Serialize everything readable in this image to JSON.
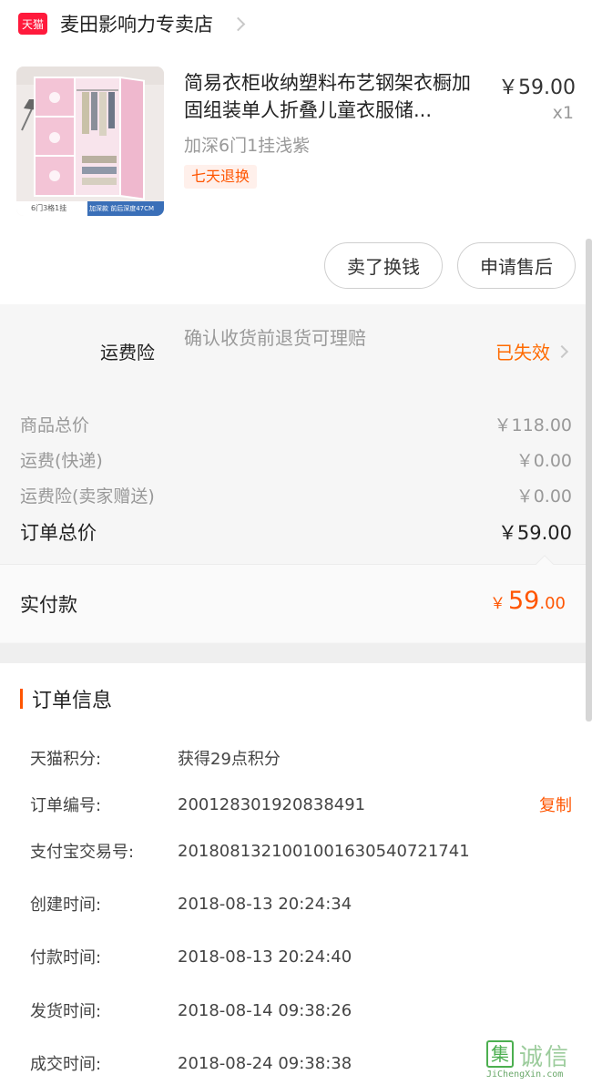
{
  "shop": {
    "badge": "天猫",
    "name": "麦田影响力专卖店"
  },
  "product": {
    "title": "简易衣柜收纳塑料布艺钢架衣橱加固组装单人折叠儿童衣服储...",
    "price": "￥59.00",
    "qty": "x1",
    "spec": "加深6门1挂浅紫",
    "return_tag": "七天退换",
    "thumb_caption_left": "6门3格1挂",
    "thumb_caption_right": "加深款 前后深度47CM",
    "thumb_colors": {
      "panel": "#efb8ce",
      "frame": "#efeae8"
    }
  },
  "actions": {
    "sell": "卖了换钱",
    "aftersale": "申请售后"
  },
  "insurance": {
    "label": "运费险",
    "desc": "确认收货前退货可理赔",
    "status": "已失效"
  },
  "summary": {
    "rows": [
      {
        "label": "商品总价",
        "value": "￥118.00"
      },
      {
        "label": "运费(快递)",
        "value": "￥0.00"
      },
      {
        "label": "运费险(卖家赠送)",
        "value": "￥0.00"
      }
    ],
    "total_label": "订单总价",
    "total_value": "￥59.00"
  },
  "paid": {
    "label": "实付款",
    "currency": "￥",
    "integer": "59",
    "decimal": ".00"
  },
  "order_info": {
    "title": "订单信息",
    "copy_label": "复制",
    "rows": [
      {
        "k": "天猫积分:",
        "v": "获得29点积分"
      },
      {
        "k": "订单编号:",
        "v": "200128301920838491"
      },
      {
        "k": "支付宝交易号:",
        "v": "2018081321001001630540721741"
      },
      {
        "k": "创建时间:",
        "v": "2018-08-13 20:24:34"
      },
      {
        "k": "付款时间:",
        "v": "2018-08-13 20:24:40"
      },
      {
        "k": "发货时间:",
        "v": "2018-08-14 09:38:26"
      },
      {
        "k": "成交时间:",
        "v": "2018-08-24 09:38:38"
      }
    ]
  },
  "watermark": {
    "glyph": "集",
    "cn": "诚信",
    "en": "JiChengXin.com"
  },
  "colors": {
    "accent": "#ff5500",
    "tmall_red": "#ff1a3c",
    "status_orange": "#ff6a00"
  }
}
